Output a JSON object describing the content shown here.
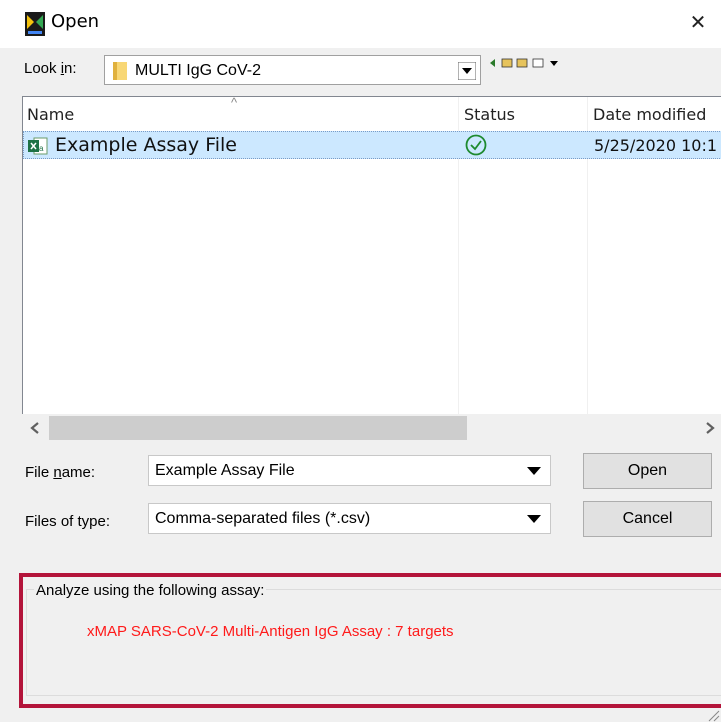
{
  "window": {
    "title": "Open",
    "close_symbol": "✕"
  },
  "look_in": {
    "label": "Look in:",
    "value": "MULTI IgG CoV-2"
  },
  "file_list": {
    "columns": [
      "Name",
      "Status",
      "Date modified"
    ],
    "sort_indicator": "^",
    "rows": [
      {
        "name": "Example Assay File",
        "status_icon": "check-circle-icon",
        "date_modified": "5/25/2020 10:1"
      }
    ]
  },
  "scrollbar": {
    "left_arrow": "<",
    "right_arrow": ">"
  },
  "file_name": {
    "label": "File name:",
    "value": "Example Assay File"
  },
  "file_type": {
    "label": "Files of type:",
    "value": "Comma-separated files (*.csv)"
  },
  "buttons": {
    "open": "Open",
    "cancel": "Cancel"
  },
  "assay": {
    "legend": "Analyze using the following assay:",
    "value": "xMAP SARS-CoV-2 Multi-Antigen IgG Assay : 7 targets",
    "value_color": "#ff1a1a",
    "highlight_color": "#b3143a"
  },
  "selection_color": "#cce8ff"
}
